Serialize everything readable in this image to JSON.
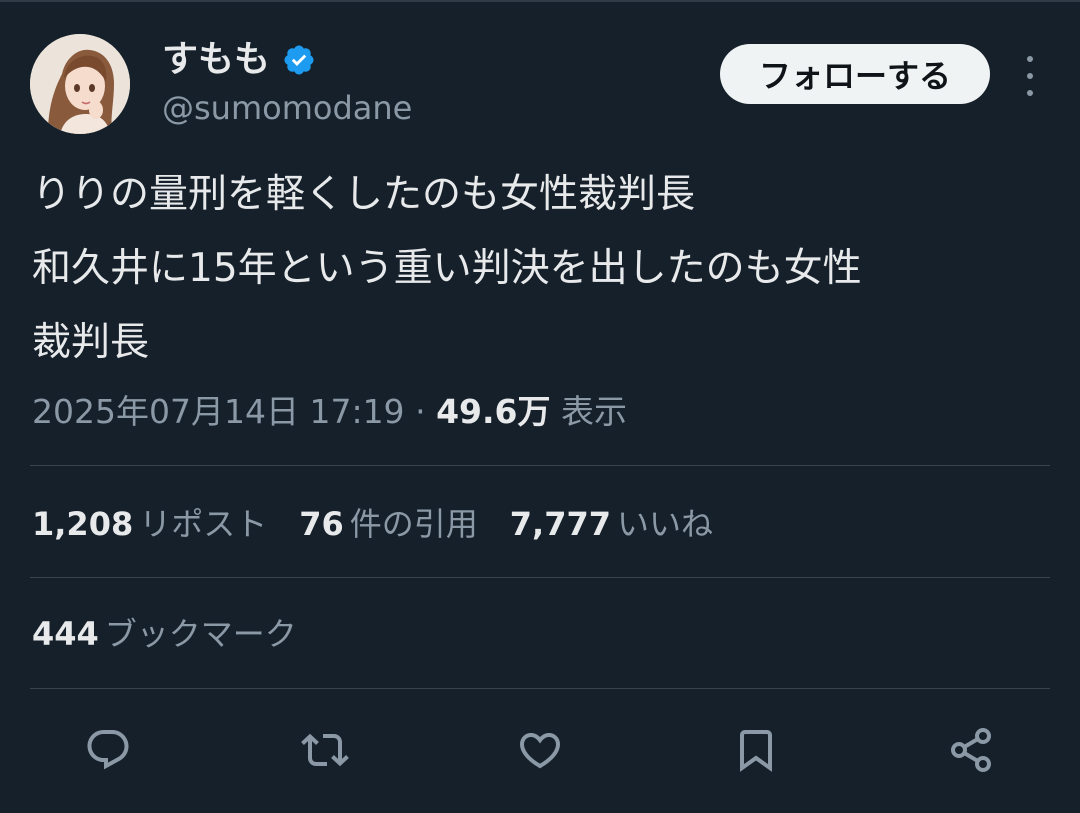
{
  "author": {
    "display_name": "すもも",
    "handle": "@sumomodane",
    "verified": true,
    "avatar_icon": "avatar-illustration"
  },
  "follow_button": {
    "label": "フォローする"
  },
  "more_icon": "more-vertical-icon",
  "tweet": {
    "lines": [
      "りりの量刑を軽くしたのも女性裁判長",
      "和久井に15年という重い判決を出したのも女性",
      "裁判長"
    ]
  },
  "meta": {
    "datetime": "2025年07月14日 17:19",
    "separator": "·",
    "views": "49.6万",
    "views_label": "表示"
  },
  "stats": {
    "reposts": {
      "count": "1,208",
      "label": "リポスト"
    },
    "quotes": {
      "count": "76",
      "label": "件の引用"
    },
    "likes": {
      "count": "7,777",
      "label": "いいね"
    },
    "bookmarks": {
      "count": "444",
      "label": "ブックマーク"
    }
  },
  "actions": [
    "reply-icon",
    "repost-icon",
    "like-icon",
    "bookmark-icon",
    "share-icon"
  ],
  "colors": {
    "background": "#15202b",
    "text_primary": "#e7e9ea",
    "text_secondary": "#8b98a5",
    "divider": "#38444d",
    "verified_blue": "#1d9bf0",
    "follow_bg": "#eff3f4"
  }
}
